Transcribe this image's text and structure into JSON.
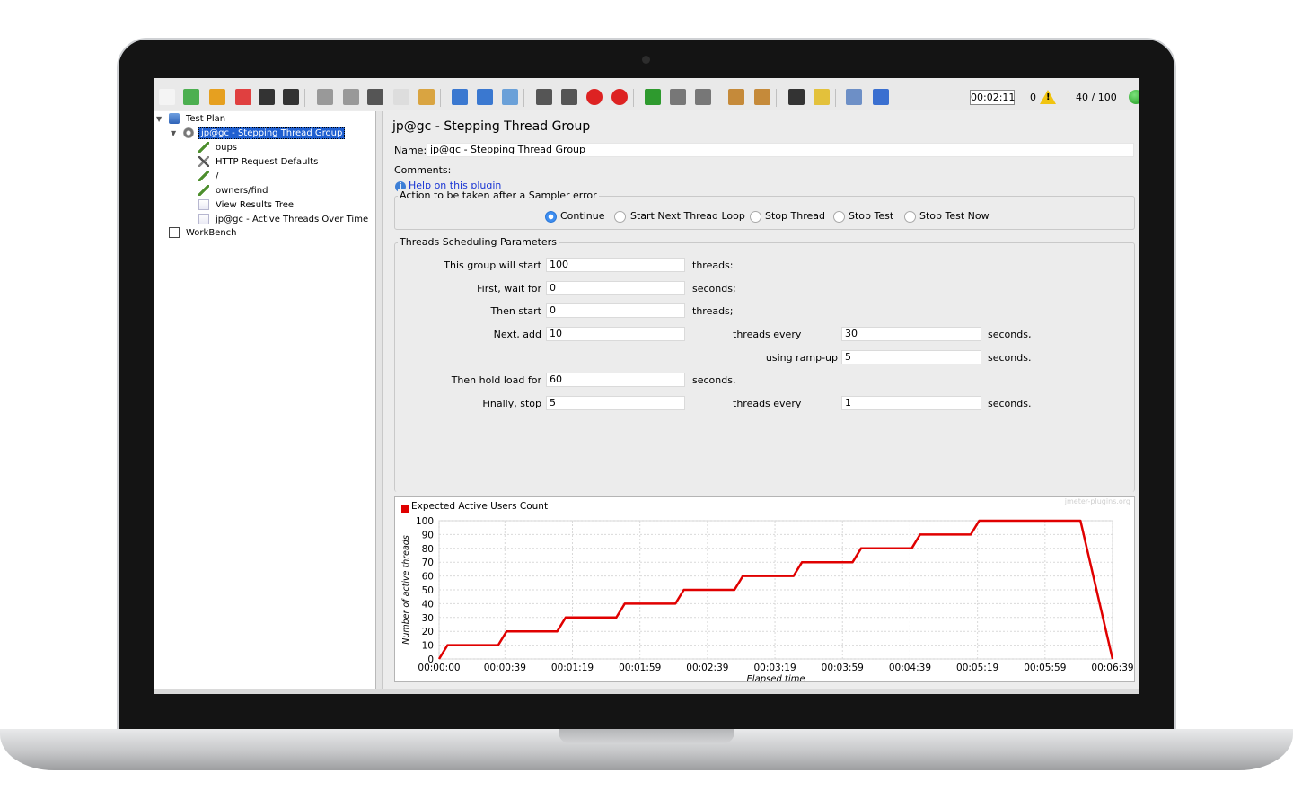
{
  "toolbar": {
    "timer": "00:02:11",
    "errors": "0",
    "threads": "40 / 100",
    "icons": [
      "new-icon",
      "templates-icon",
      "open-icon",
      "close-icon",
      "save-icon",
      "save-as-icon",
      "undo-icon",
      "redo-icon",
      "cut-icon",
      "copy-icon",
      "paste-icon",
      "expand-icon",
      "collapse-icon",
      "toggle-icon",
      "start-icon",
      "start-no-pause-icon",
      "stop-icon",
      "shutdown-icon",
      "remote-start-icon",
      "remote-stop-icon",
      "remote-shutdown-icon",
      "clear-icon",
      "clear-all-icon",
      "search-icon",
      "reset-search-icon",
      "function-helper-icon",
      "help-icon"
    ]
  },
  "tree": {
    "items": [
      {
        "label": "Test Plan",
        "icon": "test-plan-icon"
      },
      {
        "label": "jp@gc - Stepping Thread Group",
        "icon": "thread-group-icon",
        "selected": true
      },
      {
        "label": "oups",
        "icon": "sampler-icon"
      },
      {
        "label": "HTTP Request Defaults",
        "icon": "config-icon"
      },
      {
        "label": "/",
        "icon": "sampler-icon"
      },
      {
        "label": "owners/find",
        "icon": "sampler-icon"
      },
      {
        "label": "View Results Tree",
        "icon": "listener-icon"
      },
      {
        "label": "jp@gc - Active Threads Over Time",
        "icon": "listener-icon"
      },
      {
        "label": "WorkBench",
        "icon": "workbench-icon"
      }
    ]
  },
  "panel": {
    "title": "jp@gc - Stepping Thread Group",
    "name_label": "Name:",
    "name_value": "jp@gc - Stepping Thread Group",
    "comments_label": "Comments:",
    "help_link": "Help on this plugin",
    "error_action": {
      "legend": "Action to be taken after a Sampler error",
      "options": [
        "Continue",
        "Start Next Thread Loop",
        "Stop Thread",
        "Stop Test",
        "Stop Test Now"
      ],
      "selected": "Continue"
    },
    "scheduling": {
      "legend": "Threads Scheduling Parameters",
      "start_label": "This group will start",
      "start_value": "100",
      "start_unit": "threads:",
      "wait_label": "First, wait for",
      "wait_value": "0",
      "wait_unit": "seconds;",
      "then_start_label": "Then start",
      "then_start_value": "0",
      "then_start_unit": "threads;",
      "next_add_label": "Next, add",
      "next_add_value": "10",
      "threads_every_label": "threads every",
      "threads_every_value": "30",
      "seconds_comma": "seconds,",
      "rampup_label": "using ramp-up",
      "rampup_value": "5",
      "seconds_dot": "seconds.",
      "hold_label": "Then hold load for",
      "hold_value": "60",
      "stop_label": "Finally, stop",
      "stop_value": "5",
      "stop_every_label": "threads every",
      "stop_every_value": "1"
    }
  },
  "chart_data": {
    "type": "line",
    "series": [
      {
        "name": "Expected Active Users Count",
        "color": "#e00000",
        "x": [
          "00:00:00",
          "00:00:05",
          "00:00:35",
          "00:00:40",
          "00:01:10",
          "00:01:15",
          "00:01:45",
          "00:01:50",
          "00:02:20",
          "00:02:25",
          "00:02:55",
          "00:03:00",
          "00:03:30",
          "00:03:35",
          "00:04:05",
          "00:04:10",
          "00:04:40",
          "00:04:45",
          "00:05:15",
          "00:05:20",
          "00:06:20",
          "00:06:39"
        ],
        "y": [
          0,
          10,
          10,
          20,
          20,
          30,
          30,
          40,
          40,
          50,
          50,
          60,
          60,
          70,
          70,
          80,
          80,
          90,
          90,
          100,
          100,
          0
        ]
      }
    ],
    "x_ticks": [
      "00:00:00",
      "00:00:39",
      "00:01:19",
      "00:01:59",
      "00:02:39",
      "00:03:19",
      "00:03:59",
      "00:04:39",
      "00:05:19",
      "00:05:59",
      "00:06:39"
    ],
    "y_ticks": [
      0,
      10,
      20,
      30,
      40,
      50,
      60,
      70,
      80,
      90,
      100
    ],
    "xlabel": "Elapsed time",
    "ylabel": "Number of active threads",
    "ylim": [
      0,
      100
    ],
    "grid": true,
    "legend": "top-left",
    "watermark": "jmeter-plugins.org"
  }
}
